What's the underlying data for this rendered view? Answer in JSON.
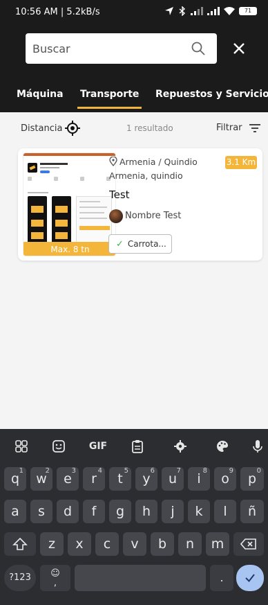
{
  "status_bar": {
    "time_speed": "10:56 AM | 5.2kB/s",
    "battery": "71"
  },
  "search": {
    "placeholder": "Buscar",
    "value": ""
  },
  "tabs": [
    {
      "label": "Máquina"
    },
    {
      "label": "Transporte"
    },
    {
      "label": "Repuestos y Servicios"
    }
  ],
  "filter_bar": {
    "distance_label": "Distancia",
    "result_count": "1 resultado",
    "filter_label": "Filtrar"
  },
  "listing": {
    "location": "Armenia / Quindio",
    "location_detail": "Armenia, quindio",
    "distance": "3.1 Km",
    "title": "Test",
    "owner": "Nombre Test",
    "tag": "Carrota...",
    "capacity": "Max. 8 tn"
  },
  "keyboard": {
    "toolbar": [
      "grid-icon",
      "sticker-icon",
      "GIF",
      "clipboard-icon",
      "settings-icon",
      "palette-icon",
      "mic-icon"
    ],
    "row1": [
      {
        "k": "q",
        "n": "1"
      },
      {
        "k": "w",
        "n": "2"
      },
      {
        "k": "e",
        "n": "3"
      },
      {
        "k": "r",
        "n": "4"
      },
      {
        "k": "t",
        "n": "5"
      },
      {
        "k": "y",
        "n": "6"
      },
      {
        "k": "u",
        "n": "7"
      },
      {
        "k": "i",
        "n": "8"
      },
      {
        "k": "o",
        "n": "9"
      },
      {
        "k": "p",
        "n": "0"
      }
    ],
    "row2": [
      "a",
      "s",
      "d",
      "f",
      "g",
      "h",
      "j",
      "k",
      "l",
      "ñ"
    ],
    "row3": [
      "z",
      "x",
      "c",
      "v",
      "b",
      "n",
      "m"
    ],
    "symbols_key": "?123",
    "period_key": ".",
    "comma_key": ","
  },
  "colors": {
    "accent": "#f3b63a",
    "header_bg": "#1b1b1b",
    "keyboard_bg": "#2b2d31"
  }
}
